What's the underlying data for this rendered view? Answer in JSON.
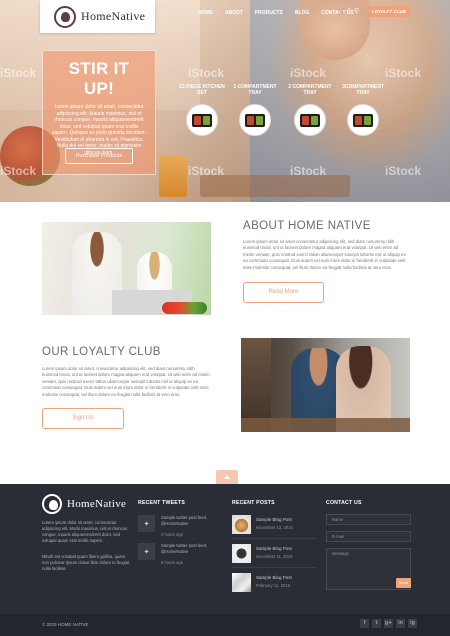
{
  "header": {
    "logo_text": "HomeNative",
    "nav": [
      "HOME",
      "ABOUT",
      "PRODUCTS",
      "BLOG",
      "CONTACT US"
    ],
    "cart_count": "0",
    "cart_icon": "cart-icon",
    "search_icon": "search-icon",
    "loyalty_button": "LOYALTY CLUB"
  },
  "hero": {
    "title": "STIR IT UP!",
    "body": "Lorem ipsum dolor sit amet, consectetur adipiscing elit. Mauris maximus, nisl et rhoncus congue, mauris aliquamendrerit dolor, sed volutpat quam erat mollis sapien. Quisque ex justo gravida tincidunt. Vestibulum id pharetra in est. Phasellus. Nulla dui vel tortor, mattis sit dignissim ultrices diam.",
    "button": "Purchase Products",
    "watermark": "iStock",
    "products": [
      {
        "label": "23 PIECE KITCHEN SET"
      },
      {
        "label": "1 COMPARTMENT TRAY"
      },
      {
        "label": "2 COMPARTMENT TRAY"
      },
      {
        "label": "3COMPARTMENT TRAY"
      }
    ]
  },
  "about": {
    "title": "ABOUT HOME NATIVE",
    "text": "Lorem ipsum dolor sit amet consectetur adipiscing elit, sed diam nonummy nibh euismod tincid, unt ut laoreet dolore magna aliquam erat volutpat. Ut wisi enim ad minim veniam, quis nostrud exerci tation ullamcorper suscipit lobortis nisl ut aliquip ex ea commodo consequat. Duis autem vel eum iriure dolor in hendrerit in vulputate velit esse molestie consequat, vel illum dolore eu feugiat nulla facilisis at vero eros.",
    "button": "Read More"
  },
  "loyalty": {
    "title": "OUR LOYALTY CLUB",
    "text": "Lorem ipsum dolor sit amet, consectetur adipiscing elit, sed diam nonummy nibh euismod tincid, unt ut laoreet dolore magna aliquam erat volutpat. Ut wisi enim ad minim veniam, quis nostrud exerci tation ullamcorper suscipit lobortis nisl ut aliquip ex ea commodo consequat. Duis autem vel eum iriure dolor in hendrerit in vulputate velit esse molestie consequat, vel illum dolore eu feugiat nulla facilisis at vero eros.",
    "button": "Sign Up"
  },
  "footer": {
    "logo_text": "HomeNative",
    "about_text": "Lorem ipsum dolor sit amet, consectetur adipiscing elit. Morbi maximus, nisl et rhoncus congue, mauris aliquamendrerit dolor, sed volutpat quam erat mollis sapien.",
    "about_text2": "Mituth est volutpat quam libero gallina, quam non pulvinar ipsum clasur libin dolore to feugiat nulla facilisis.",
    "tweets_heading": "RECENT TWEETS",
    "tweets": [
      {
        "text": "Sample twitter post feed. @HomeNative",
        "time": "3 hours ago"
      },
      {
        "text": "Sample twitter post feed. @HomeNative",
        "time": "8 hours ago"
      }
    ],
    "posts_heading": "RECENT POSTS",
    "posts": [
      {
        "title": "Sample Blog Post",
        "date": "November 13, 2015"
      },
      {
        "title": "Sample Blog Post",
        "date": "November 11, 2015"
      },
      {
        "title": "Sample Blog Post",
        "date": "February 11, 2015"
      }
    ],
    "contact_heading": "CONTACT US",
    "contact_name": "Name",
    "contact_email": "E-mail",
    "contact_message": "Message",
    "send": "Send",
    "copyright": "© 2015 HOME NATIVE",
    "socials": [
      "f",
      "t",
      "g+",
      "in",
      "ig"
    ]
  }
}
